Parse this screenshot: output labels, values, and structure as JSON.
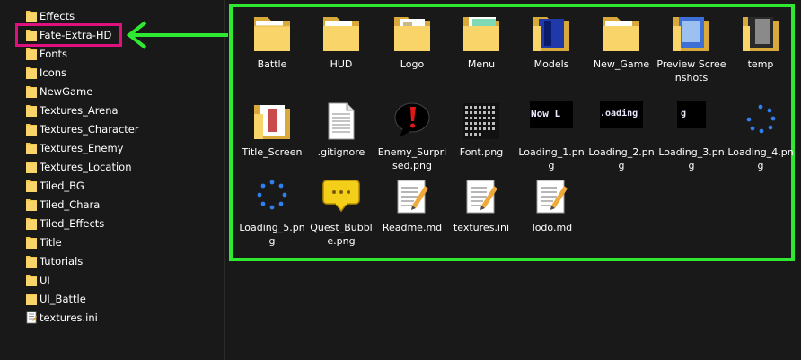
{
  "tree": {
    "items": [
      {
        "label": "Effects",
        "icon": "folder-icon"
      },
      {
        "label": "Fate-Extra-HD",
        "icon": "folder-icon"
      },
      {
        "label": "Fonts",
        "icon": "folder-icon"
      },
      {
        "label": "Icons",
        "icon": "folder-icon"
      },
      {
        "label": "NewGame",
        "icon": "folder-icon"
      },
      {
        "label": "Textures_Arena",
        "icon": "folder-icon"
      },
      {
        "label": "Textures_Character",
        "icon": "folder-icon"
      },
      {
        "label": "Textures_Enemy",
        "icon": "folder-icon"
      },
      {
        "label": "Textures_Location",
        "icon": "folder-icon"
      },
      {
        "label": "Tiled_BG",
        "icon": "folder-icon"
      },
      {
        "label": "Tiled_Chara",
        "icon": "folder-icon"
      },
      {
        "label": "Tiled_Effects",
        "icon": "folder-icon"
      },
      {
        "label": "Title",
        "icon": "folder-icon"
      },
      {
        "label": "Tutorials",
        "icon": "folder-icon"
      },
      {
        "label": "UI",
        "icon": "folder-icon"
      },
      {
        "label": "UI_Battle",
        "icon": "folder-icon"
      },
      {
        "label": "textures.ini",
        "icon": "text-file-icon"
      }
    ]
  },
  "grid": {
    "items": [
      {
        "label": "Battle",
        "icon": "folder-icon"
      },
      {
        "label": "HUD",
        "icon": "folder-icon"
      },
      {
        "label": "Logo",
        "icon": "folder-icon"
      },
      {
        "label": "Menu",
        "icon": "folder-icon"
      },
      {
        "label": "Models",
        "icon": "folder-icon"
      },
      {
        "label": "New_Game",
        "icon": "folder-icon"
      },
      {
        "label": "Preview Screenshots",
        "icon": "folder-icon"
      },
      {
        "label": "temp",
        "icon": "folder-icon"
      },
      {
        "label": "Title_Screen",
        "icon": "folder-icon"
      },
      {
        "label": ".gitignore",
        "icon": "document-icon"
      },
      {
        "label": "Enemy_Surprised.png",
        "icon": "exclamation-bubble-icon"
      },
      {
        "label": "Font.png",
        "icon": "font-atlas-icon"
      },
      {
        "label": "Loading_1.png",
        "icon": "loading-text-image-icon"
      },
      {
        "label": "Loading_2.png",
        "icon": "loading-text-image-icon"
      },
      {
        "label": "Loading_3.png",
        "icon": "loading-text-image-icon"
      },
      {
        "label": "Loading_4.png",
        "icon": "loading-spinner-icon"
      },
      {
        "label": "Loading_5.png",
        "icon": "loading-spinner-icon"
      },
      {
        "label": "Quest_Bubble.png",
        "icon": "speech-bubble-icon"
      },
      {
        "label": "Readme.md",
        "icon": "notepad-icon"
      },
      {
        "label": "textures.ini",
        "icon": "notepad-icon"
      },
      {
        "label": "Todo.md",
        "icon": "notepad-icon"
      }
    ],
    "thumb_text": {
      "loading1": "Now L",
      "loading2": ".oading",
      "loading3": "g"
    }
  },
  "colors": {
    "highlight_pink": "#e0107f",
    "highlight_green": "#2ee832",
    "background": "#191919",
    "folder": "#f5c94c"
  }
}
